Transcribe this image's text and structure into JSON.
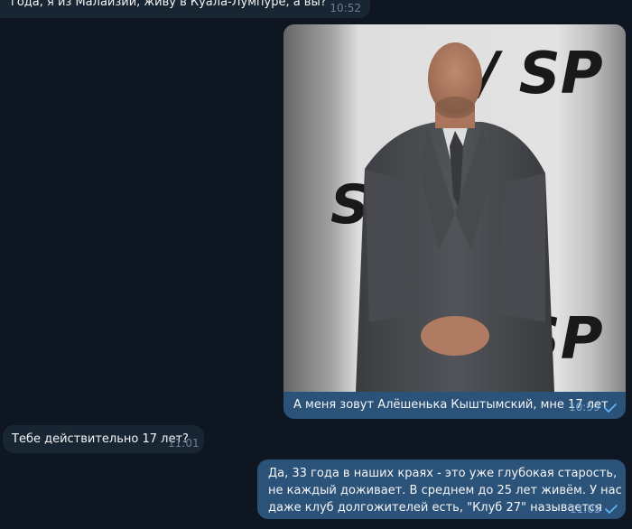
{
  "messages": [
    {
      "direction": "incoming",
      "text": "года, я из Малайзии, живу в Куала-Лумпуре, а вы?",
      "time": "10:52"
    },
    {
      "direction": "outgoing",
      "has_photo": true,
      "photo_backdrop_text": [
        "/ SP",
        "SP",
        "/ SP"
      ],
      "text": "А меня зовут Алёшенька Кыштымский, мне 17 лет",
      "time": "10:59",
      "status": "read-check-icon"
    },
    {
      "direction": "incoming",
      "text": "Тебе действительно 17 лет?",
      "time": "11:01"
    },
    {
      "direction": "outgoing",
      "text": "Да, 33 года в наших краях - это уже глубокая старость, не каждый доживает. В среднем до 25 лет живём. У нас даже клуб долгожителей есть, \"Клуб 27\" называется",
      "time": "11:05",
      "status": "read-check-icon"
    }
  ],
  "colors": {
    "background": "#0e1621",
    "incoming_bubble": "#182533",
    "outgoing_bubble": "#2b5278",
    "text": "#f5f5f5",
    "incoming_time": "#6d7f8f",
    "outgoing_time": "#7da8d3"
  }
}
